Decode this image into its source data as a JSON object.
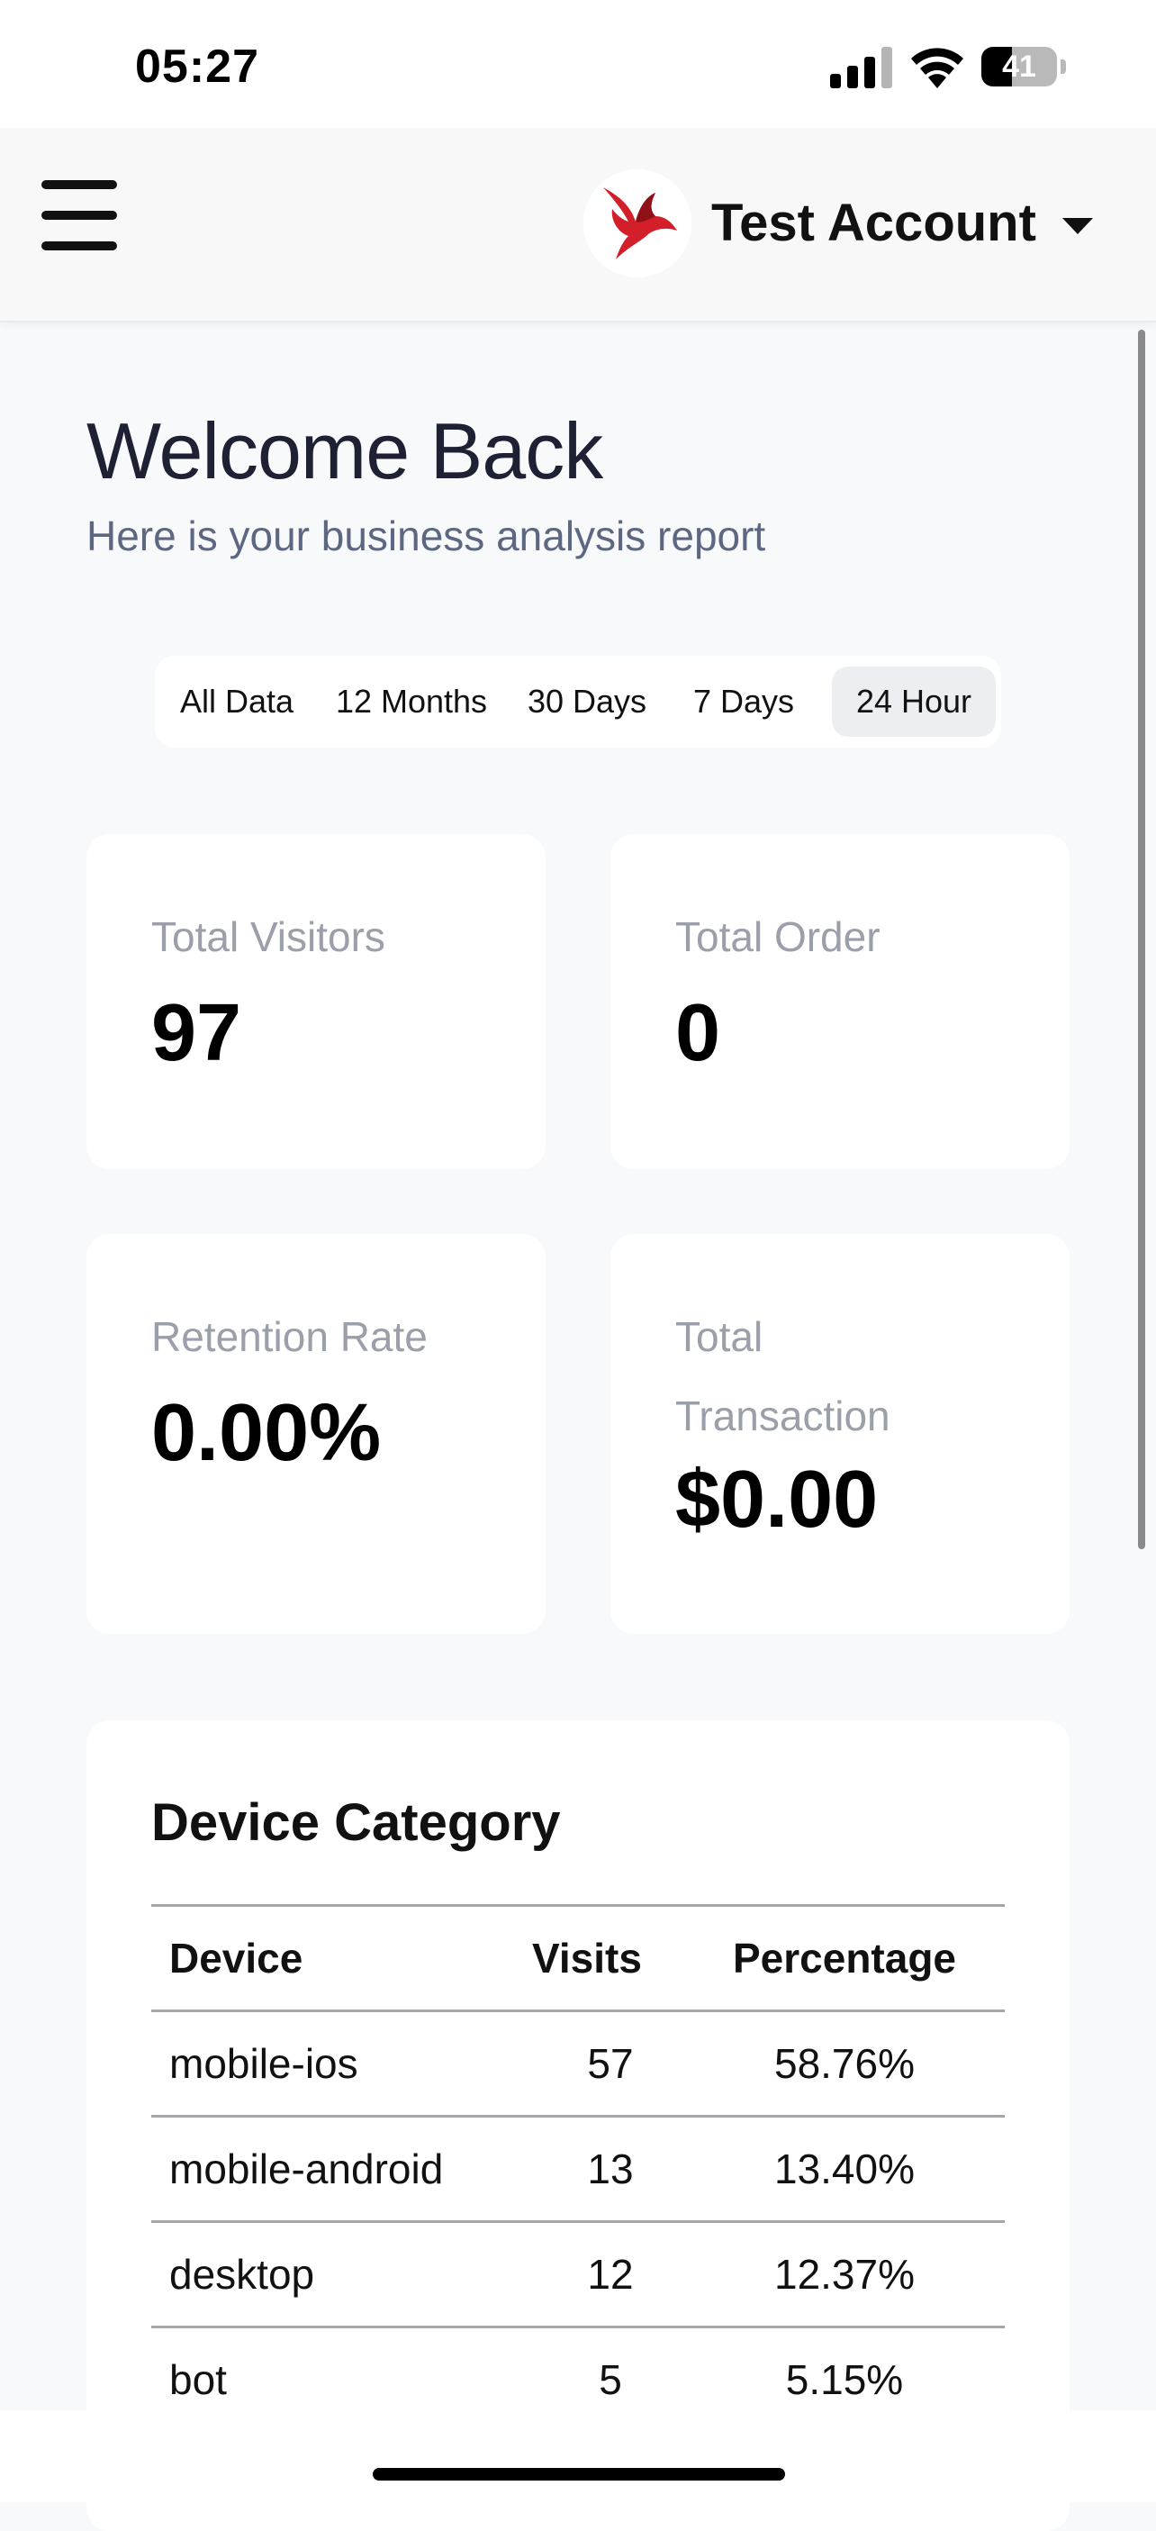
{
  "status_bar": {
    "time": "05:27",
    "battery": "41",
    "battery_level": 0.41
  },
  "header": {
    "account_name": "Test Account"
  },
  "welcome": {
    "title": "Welcome Back",
    "subtitle": "Here is your business analysis report"
  },
  "range_tabs": [
    {
      "label": "All Data",
      "active": false
    },
    {
      "label": "12 Months",
      "active": false
    },
    {
      "label": "30 Days",
      "active": false
    },
    {
      "label": "7 Days",
      "active": false
    },
    {
      "label": "24 Hour",
      "active": true
    }
  ],
  "stats": [
    {
      "label": "Total Visitors",
      "value": "97"
    },
    {
      "label": "Total Order",
      "value": "0"
    },
    {
      "label": "Retention Rate",
      "value": "0.00%"
    },
    {
      "label_lines": [
        "Total",
        "Transaction"
      ],
      "value": "$0.00"
    }
  ],
  "device_category": {
    "title": "Device Category",
    "columns": [
      "Device",
      "Visits",
      "Percentage"
    ],
    "rows": [
      {
        "device": "mobile-ios",
        "visits": "57",
        "percentage": "58.76%"
      },
      {
        "device": "mobile-android",
        "visits": "13",
        "percentage": "13.40%"
      },
      {
        "device": "desktop",
        "visits": "12",
        "percentage": "12.37%"
      },
      {
        "device": "bot",
        "visits": "5",
        "percentage": "5.15%"
      }
    ]
  },
  "colors": {
    "logo_red": "#d21f2a",
    "card_bg": "#ffffff",
    "page_bg": "#f8f9fb",
    "label_gray": "#9a9fa9"
  },
  "icons": {
    "menu": "hamburger-icon",
    "logo": "bird-logo",
    "dropdown": "caret-down-icon"
  }
}
